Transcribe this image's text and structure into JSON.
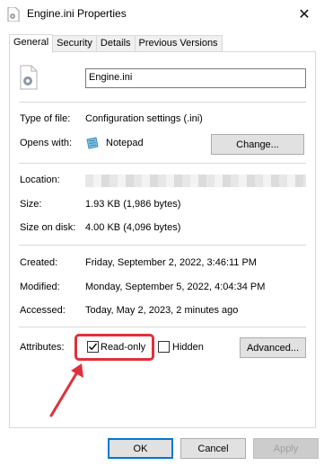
{
  "window": {
    "title": "Engine.ini Properties",
    "close_glyph": "✕"
  },
  "tabs": [
    {
      "label": "General",
      "active": true
    },
    {
      "label": "Security",
      "active": false
    },
    {
      "label": "Details",
      "active": false
    },
    {
      "label": "Previous Versions",
      "active": false
    }
  ],
  "general": {
    "file_name": "Engine.ini",
    "type_of_file_label": "Type of file:",
    "type_of_file_value": "Configuration settings (.ini)",
    "opens_with_label": "Opens with:",
    "opens_with_value": "Notepad",
    "change_button": "Change...",
    "location_label": "Location:",
    "size_label": "Size:",
    "size_value": "1.93 KB (1,986 bytes)",
    "size_on_disk_label": "Size on disk:",
    "size_on_disk_value": "4.00 KB (4,096 bytes)",
    "created_label": "Created:",
    "created_value": "Friday, September 2, 2022, 3:46:11 PM",
    "modified_label": "Modified:",
    "modified_value": "Monday, September 5, 2022, 4:04:34 PM",
    "accessed_label": "Accessed:",
    "accessed_value": "Today, May 2, 2023, 2 minutes ago",
    "attributes_label": "Attributes:",
    "readonly_label": "Read-only",
    "readonly_checked": true,
    "hidden_label": "Hidden",
    "hidden_checked": false,
    "advanced_button": "Advanced..."
  },
  "footer": {
    "ok": "OK",
    "cancel": "Cancel",
    "apply": "Apply"
  },
  "annotation": {
    "highlight_color": "#e0303a"
  }
}
